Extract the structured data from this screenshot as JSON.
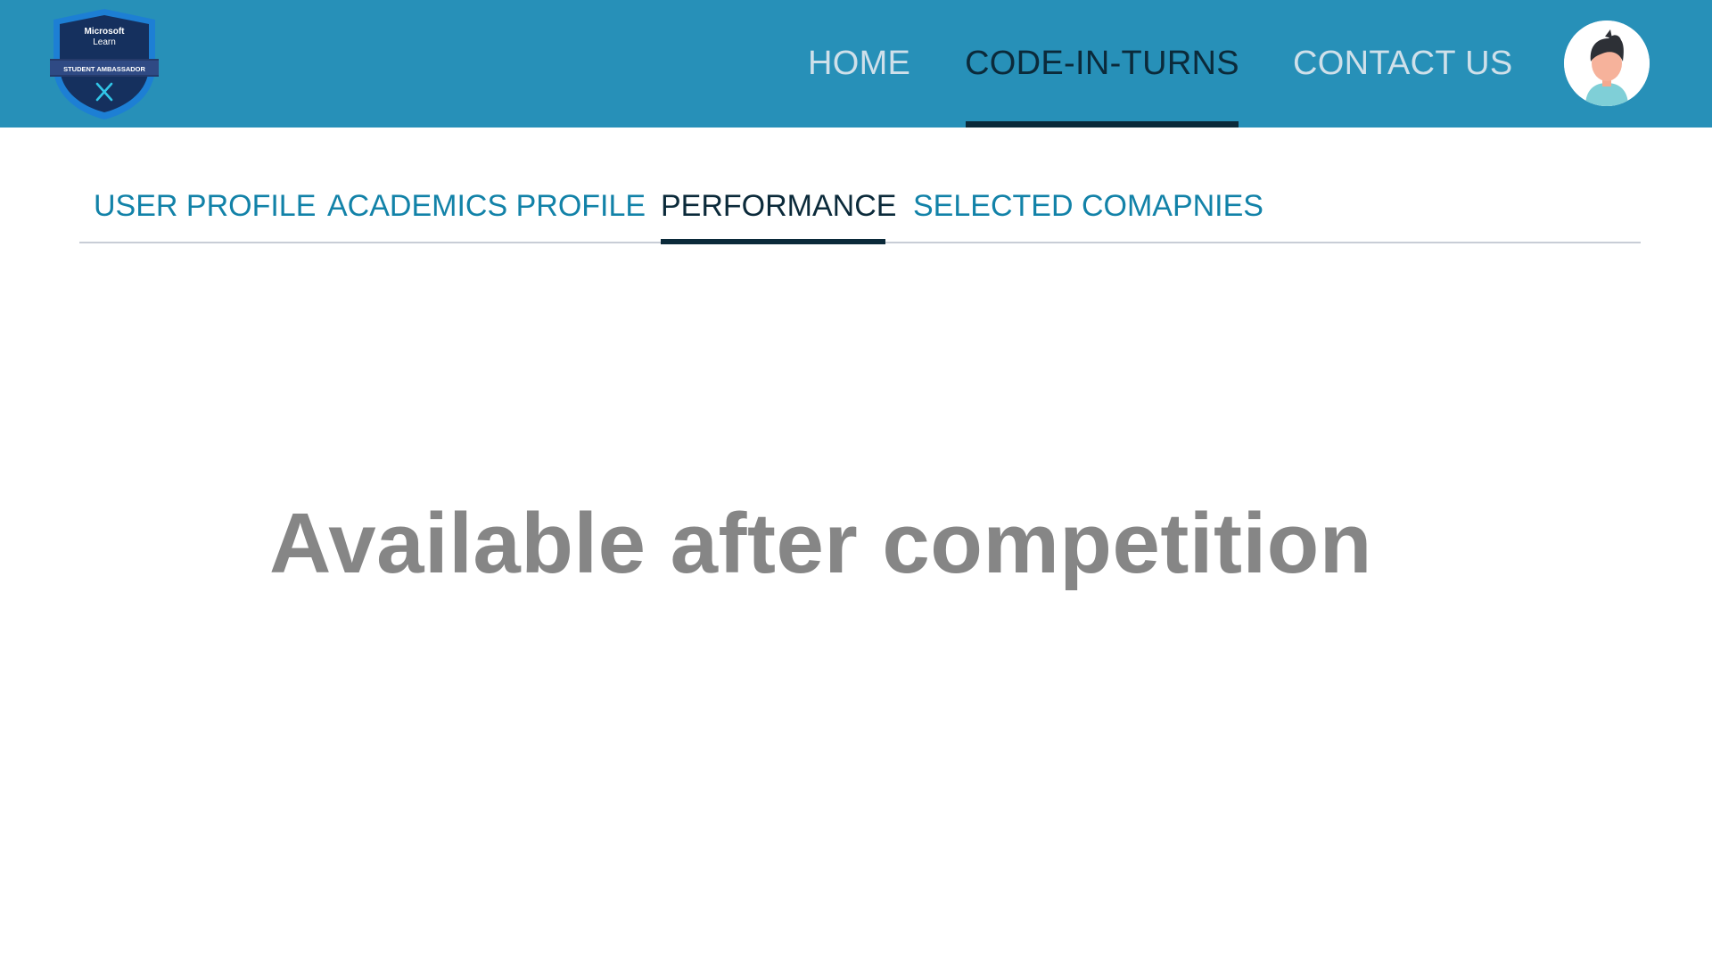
{
  "header": {
    "logo": {
      "line1": "Microsoft",
      "line2": "Learn",
      "banner": "STUDENT AMBASSADOR"
    },
    "nav": [
      {
        "label": "HOME"
      },
      {
        "label": "CODE-IN-TURNS",
        "active": true
      },
      {
        "label": "CONTACT US"
      }
    ],
    "colors": {
      "bar": "#2790b8",
      "active": "#0b2a3a",
      "inactive": "#cfe0ea"
    },
    "avatar_icon": "user-avatar-icon"
  },
  "tabs": [
    {
      "label": "USER PROFILE"
    },
    {
      "label": "ACADEMICS PROFILE"
    },
    {
      "label": "PERFORMANCE",
      "active": true
    },
    {
      "label": "SELECTED COMAPNIES"
    }
  ],
  "main": {
    "message": "Available after competition"
  }
}
